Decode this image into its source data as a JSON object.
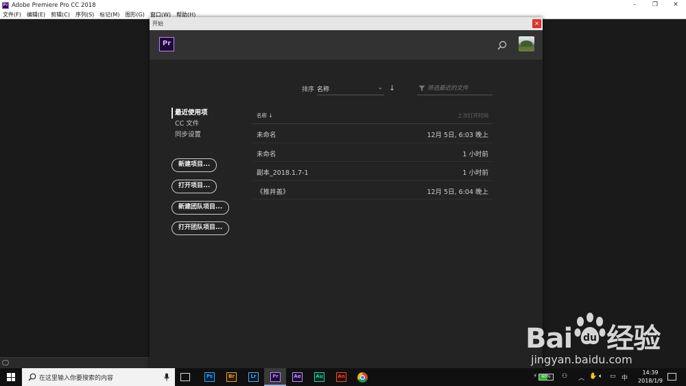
{
  "window": {
    "title": "Adobe Premiere Pro CC 2018",
    "app_icon": "Pr",
    "controls": [
      "minimize-icon",
      "restore-icon",
      "close-icon"
    ]
  },
  "menubar": {
    "items": [
      "文件(F)",
      "编辑(E)",
      "剪辑(C)",
      "序列(S)",
      "标记(M)",
      "图形(G)",
      "窗口(W)",
      "帮助(H)"
    ]
  },
  "dialog": {
    "title": "开始",
    "logo": "Pr",
    "sort": {
      "label": "排序",
      "value": "名称"
    },
    "filter": {
      "placeholder": "筛选最近的文件"
    },
    "nav": {
      "items": [
        "最近使用项",
        "CC 文件",
        "同步设置"
      ],
      "active_index": 0
    },
    "actions": {
      "new_project": "新建项目...",
      "open_project": "打开项目...",
      "new_team_project": "新建团队项目...",
      "open_team_project": "打开团队项目..."
    },
    "table": {
      "header_name": "名称",
      "header_date": "上次打开时间",
      "rows": [
        {
          "name": "未命名",
          "date": "12月 5日, 6:03 晚上"
        },
        {
          "name": "未命名",
          "date": "1 小时前"
        },
        {
          "name": "副本_2018.1.7-1",
          "date": "1 小时前"
        },
        {
          "name": "《推井盖》",
          "date": "12月 5日, 6:04 晚上"
        }
      ]
    }
  },
  "taskbar": {
    "search_placeholder": "在这里输入你要搜索的内容",
    "apps": [
      {
        "label": "Ps",
        "color": "#31a8ff"
      },
      {
        "label": "Br",
        "color": "#e8a23a"
      },
      {
        "label": "Lr",
        "color": "#64a8e0"
      },
      {
        "label": "Pr",
        "color": "#b487ff"
      },
      {
        "label": "Ae",
        "color": "#c992ff"
      },
      {
        "label": "Au",
        "color": "#2fd3a5"
      },
      {
        "label": "An",
        "color": "#e6533b"
      }
    ],
    "battery_percent": 60,
    "battery_text": "60%",
    "ime": "中",
    "time": "14:39",
    "date": "2018/1/9"
  },
  "watermark": {
    "logo": "Bai 经验",
    "url": "jingyan.baidu.com"
  }
}
